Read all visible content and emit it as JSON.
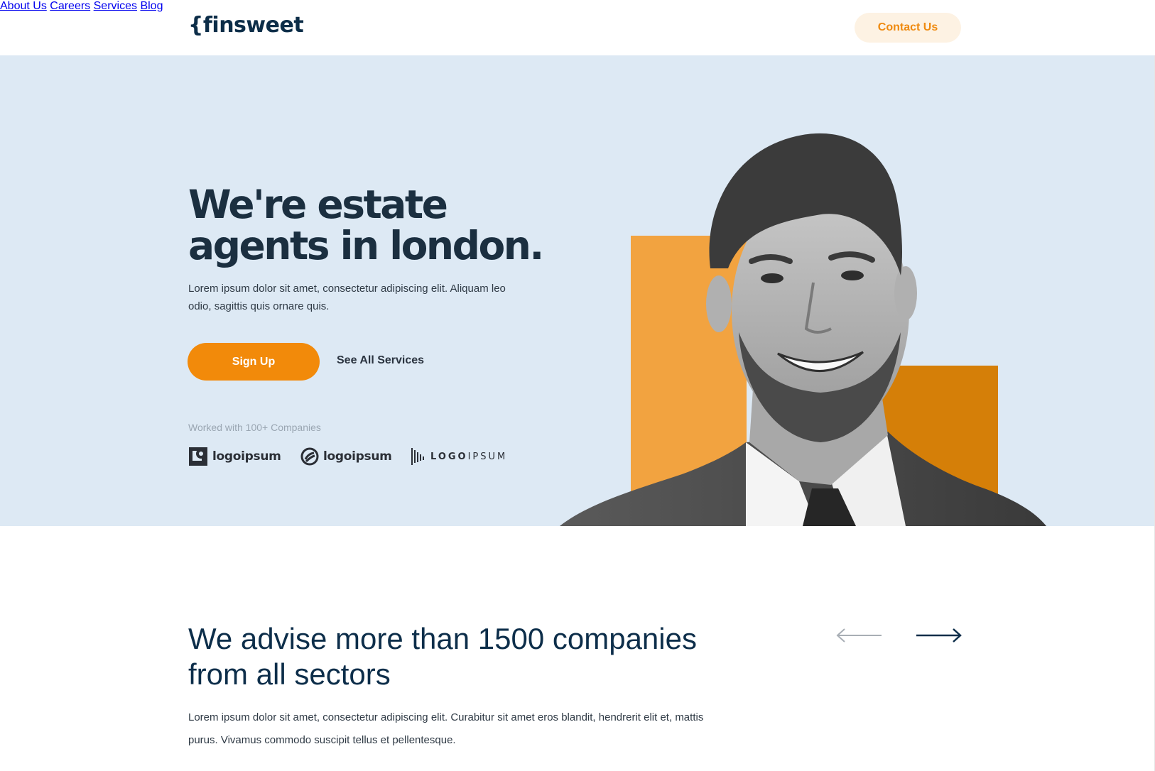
{
  "header": {
    "logo": "{finsweet",
    "nav": [
      "About Us",
      "Careers",
      "Services",
      "Blog"
    ],
    "contact_label": "Contact Us"
  },
  "hero": {
    "title_line1": "We're estate",
    "title_line2": "agents in london.",
    "description": "Lorem ipsum dolor sit amet, consectetur adipiscing elit. Aliquam leo odio, sagittis quis ornare quis.",
    "signup_label": "Sign Up",
    "see_services_label": "See All Services",
    "worked_with": "Worked with 100+ Companies",
    "logos": [
      "logoipsum",
      "logoipsum"
    ],
    "logo3_bold": "LOGO",
    "logo3_light": "IPSUM"
  },
  "section": {
    "title": "We advise more than 1500 companies from all sectors",
    "description": "Lorem ipsum dolor sit amet, consectetur adipiscing elit. Curabitur sit amet eros blandit, hendrerit elit et, mattis purus. Vivamus commodo suscipit tellus et pellentesque."
  },
  "colors": {
    "brand_navy": "#0c2d48",
    "accent_orange": "#f28a0a",
    "hero_bg": "#dde9f4"
  }
}
